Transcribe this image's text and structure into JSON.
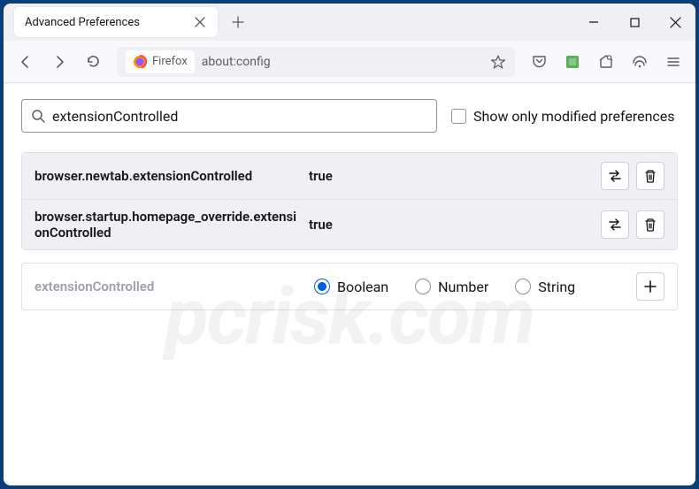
{
  "tab": {
    "title": "Advanced Preferences"
  },
  "urlbar": {
    "identity": "Firefox",
    "url": "about:config"
  },
  "search": {
    "value": "extensionControlled"
  },
  "checkbox": {
    "label": "Show only modified preferences"
  },
  "prefs": [
    {
      "name": "browser.newtab.extensionControlled",
      "value": "true"
    },
    {
      "name": "browser.startup.homepage_override.extensionControlled",
      "value": "true"
    }
  ],
  "newpref": {
    "name": "extensionControlled",
    "types": {
      "boolean": "Boolean",
      "number": "Number",
      "string": "String"
    }
  },
  "watermark": "pcrisk.com"
}
